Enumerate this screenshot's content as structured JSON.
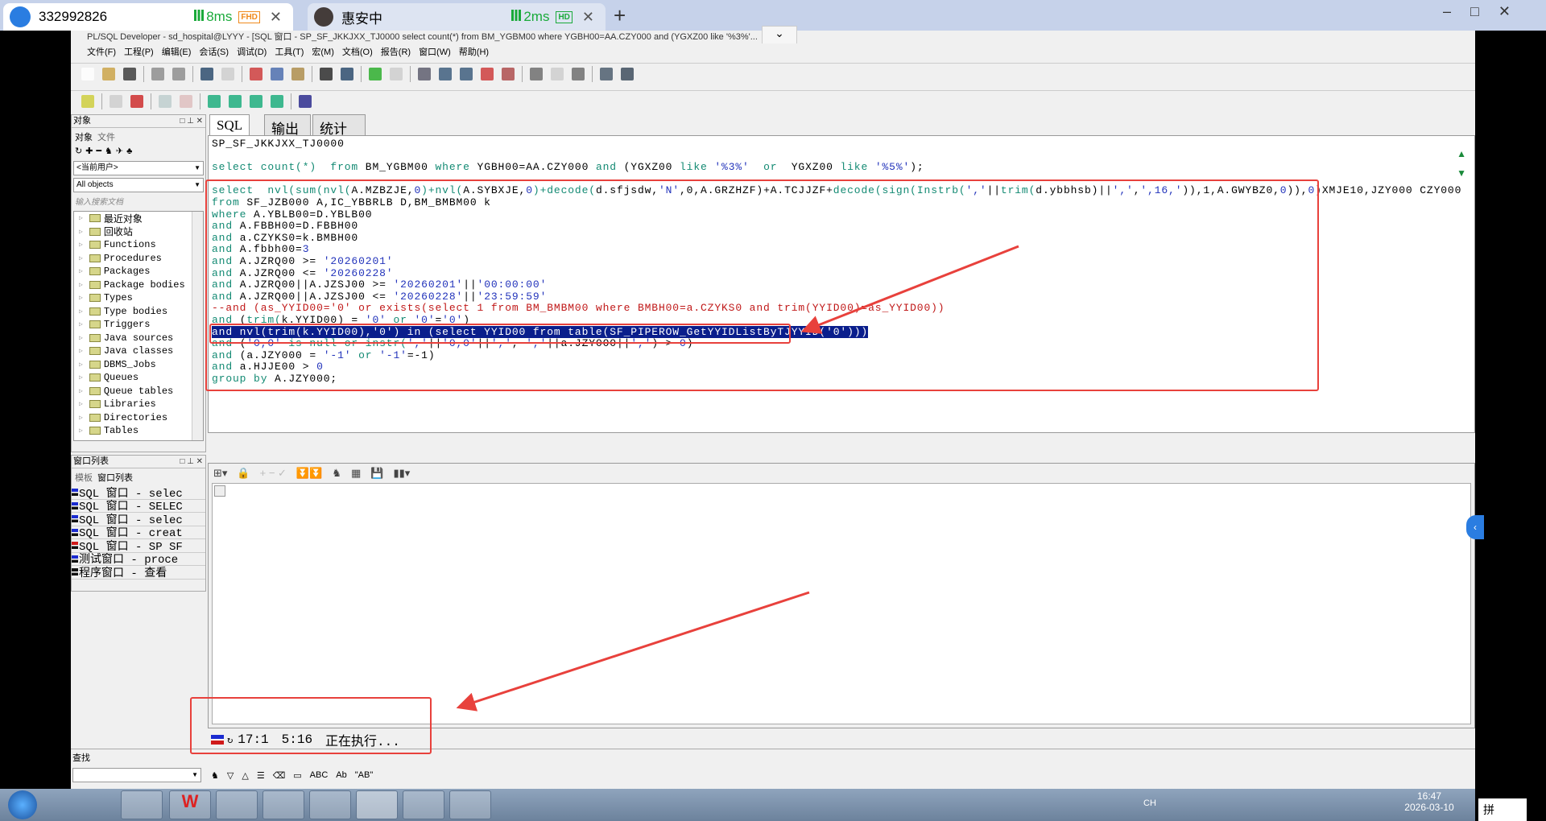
{
  "remote_tabs": [
    {
      "label": "332992826",
      "latency": "8ms",
      "quality": "FHD"
    },
    {
      "label": "惠安中",
      "latency": "2ms",
      "quality": "HD"
    }
  ],
  "window_title": "PL/SQL Developer - sd_hospital@LYYY - [SQL 窗口 - SP_SF_JKKJXX_TJ0000 select count(*) from BM_YGBM00 where YGBH00=AA.CZY000 and (YGXZ00 like '%3%'...",
  "menu": [
    "文件(F)",
    "工程(P)",
    "编辑(E)",
    "会话(S)",
    "调试(D)",
    "工具(T)",
    "宏(M)",
    "文档(O)",
    "报告(R)",
    "窗口(W)",
    "帮助(H)"
  ],
  "objects_panel": {
    "title": "对象",
    "tabs": [
      "对象",
      "文件"
    ],
    "user_combo": "<当前用户>",
    "filter_combo": "All objects",
    "search_placeholder": "输入搜索文档",
    "tree": [
      "最近对象",
      "回收站",
      "Functions",
      "Procedures",
      "Packages",
      "Package bodies",
      "Types",
      "Type bodies",
      "Triggers",
      "Java sources",
      "Java classes",
      "DBMS_Jobs",
      "Queues",
      "Queue tables",
      "Libraries",
      "Directories",
      "Tables"
    ]
  },
  "window_list": {
    "title": "窗口列表",
    "tabs": [
      "模板",
      "窗口列表"
    ],
    "items": [
      "SQL 窗口 - selec",
      "SQL 窗口 - SELEC",
      "SQL 窗口 - selec",
      "SQL 窗口 - creat",
      "SQL 窗口 - SP SF",
      "测试窗口 - proce",
      "程序窗口 - 查看"
    ]
  },
  "editor_tabs": [
    "SQL",
    "输出",
    "统计表"
  ],
  "sql_lines": [
    [
      [
        "SP_SF_JKKJXX_TJ0000",
        "pl"
      ]
    ],
    [],
    [
      [
        "select count(*)  from ",
        "kw"
      ],
      [
        "BM_YGBM00 ",
        "pl"
      ],
      [
        "where ",
        "kw"
      ],
      [
        "YGBH00=AA.CZY000 ",
        "pl"
      ],
      [
        "and ",
        "kw"
      ],
      [
        "(YGXZ00 ",
        "pl"
      ],
      [
        "like ",
        "kw"
      ],
      [
        "'%3%'",
        "str"
      ],
      [
        "  or  ",
        "kw"
      ],
      [
        "YGXZ00 ",
        "pl"
      ],
      [
        "like ",
        "kw"
      ],
      [
        "'%5%'",
        "str"
      ],
      [
        ");",
        "pl"
      ]
    ],
    [],
    [
      [
        "select  nvl(sum(nvl(",
        "kw"
      ],
      [
        "A.MZBZJE,",
        "pl"
      ],
      [
        "0",
        "num"
      ],
      [
        ")+nvl(",
        "kw"
      ],
      [
        "A.SYBXJE,",
        "pl"
      ],
      [
        "0",
        "num"
      ],
      [
        ")+decode(",
        "kw"
      ],
      [
        "d.sfjsdw,",
        "pl"
      ],
      [
        "'N'",
        "str"
      ],
      [
        ",0,",
        "pl"
      ],
      [
        "A.GRZHZF)+A.TCJJZF+",
        "pl"
      ],
      [
        "decode(sign(Instrb(",
        "kw"
      ],
      [
        "','",
        "str"
      ],
      [
        "||",
        "pl"
      ],
      [
        "trim(",
        "kw"
      ],
      [
        "d.ybbhsb)||",
        "pl"
      ],
      [
        "','",
        "str"
      ],
      [
        ",",
        "pl"
      ],
      [
        "',16,'",
        "str"
      ],
      [
        ")),1,A.GWYBZ0,",
        "pl"
      ],
      [
        "0",
        "num"
      ],
      [
        ")),",
        "pl"
      ],
      [
        "0",
        "num"
      ],
      [
        ")XMJE10,JZY000 CZY000",
        "pl"
      ]
    ],
    [
      [
        "from ",
        "kw"
      ],
      [
        "SF_JZB000 A,IC_YBBRLB D,BM_BMBM00 k",
        "pl"
      ]
    ],
    [
      [
        "where ",
        "kw"
      ],
      [
        "A.YBLB00=D.YBLB00",
        "pl"
      ]
    ],
    [
      [
        "and ",
        "kw"
      ],
      [
        "A.FBBH00=D.FBBH00",
        "pl"
      ]
    ],
    [
      [
        "and ",
        "kw"
      ],
      [
        "a.CZYKS0=k.BMBH00",
        "pl"
      ]
    ],
    [
      [
        "and ",
        "kw"
      ],
      [
        "A.fbbh00=",
        "pl"
      ],
      [
        "3",
        "num"
      ]
    ],
    [
      [
        "and ",
        "kw"
      ],
      [
        "A.JZRQ00 >= ",
        "pl"
      ],
      [
        "'20260201'",
        "str"
      ]
    ],
    [
      [
        "and ",
        "kw"
      ],
      [
        "A.JZRQ00 <= ",
        "pl"
      ],
      [
        "'20260228'",
        "str"
      ]
    ],
    [
      [
        "and ",
        "kw"
      ],
      [
        "A.JZRQ00||A.JZSJ00 >= ",
        "pl"
      ],
      [
        "'20260201'",
        "str"
      ],
      [
        "||",
        "pl"
      ],
      [
        "'00:00:00'",
        "str"
      ]
    ],
    [
      [
        "and ",
        "kw"
      ],
      [
        "A.JZRQ00||A.JZSJ00 <= ",
        "pl"
      ],
      [
        "'20260228'",
        "str"
      ],
      [
        "||",
        "pl"
      ],
      [
        "'23:59:59'",
        "str"
      ]
    ],
    [
      [
        "--and (as_YYID00='0' or exists(select 1 from BM_BMBM00 where BMBH00=a.CZYKS0 and trim(YYID00)=as_YYID00))",
        "cm"
      ]
    ],
    [
      [
        "and ",
        "kw"
      ],
      [
        "(",
        "pl"
      ],
      [
        "trim(",
        "kw"
      ],
      [
        "k.YYID00) = ",
        "pl"
      ],
      [
        "'0'",
        "str"
      ],
      [
        " or ",
        "kw"
      ],
      [
        "'0'",
        "str"
      ],
      [
        "=",
        "pl"
      ],
      [
        "'0'",
        "str"
      ],
      [
        ")",
        "pl"
      ]
    ],
    [
      [
        "and nvl(trim(k.YYID00),'0') in (select YYID00 from table(SF_PIPEROW_GetYYIDListByTJYYID('0')))",
        "sel"
      ]
    ],
    [
      [
        "and ",
        "kw"
      ],
      [
        "(",
        "pl"
      ],
      [
        "'0,0'",
        "str"
      ],
      [
        " is null or instr(",
        "kw"
      ],
      [
        "','",
        "str"
      ],
      [
        "||",
        "pl"
      ],
      [
        "'0,0'",
        "str"
      ],
      [
        "||",
        "pl"
      ],
      [
        "','",
        "str"
      ],
      [
        ", ",
        "pl"
      ],
      [
        "','",
        "str"
      ],
      [
        "||a.JZY000||",
        "pl"
      ],
      [
        "','",
        "str"
      ],
      [
        ") > ",
        "pl"
      ],
      [
        "0",
        "num"
      ],
      [
        ")",
        "pl"
      ]
    ],
    [
      [
        "and ",
        "kw"
      ],
      [
        "(a.JZY000 = ",
        "pl"
      ],
      [
        "'-1'",
        "str"
      ],
      [
        " or ",
        "kw"
      ],
      [
        "'-1'",
        "str"
      ],
      [
        "=-1)",
        "pl"
      ]
    ],
    [
      [
        "and ",
        "kw"
      ],
      [
        "a.HJJE00 > ",
        "pl"
      ],
      [
        "0",
        "num"
      ]
    ],
    [
      [
        "group by ",
        "kw"
      ],
      [
        "A.JZY000;",
        "pl"
      ]
    ]
  ],
  "status": {
    "position": "17:1",
    "col": "5:16",
    "message": "正在执行..."
  },
  "find": {
    "title": "查找"
  },
  "tray": {
    "lang": "CH",
    "time": "16:47",
    "date": "2026-03-10",
    "ime": "拼"
  },
  "colors": {
    "highlight": "#0a1e8c",
    "annotation_red": "#e8413c",
    "keyword": "#138a73",
    "string": "#2233bb",
    "comment": "#c01818"
  }
}
